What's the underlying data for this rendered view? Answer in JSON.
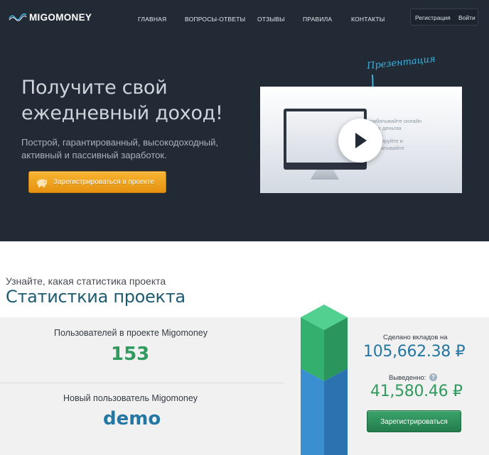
{
  "header": {
    "logo_text": "MIGOMONEY",
    "nav": [
      {
        "label": "ГЛАВНАЯ"
      },
      {
        "label": "ВОПРОСЫ-ОТВЕТЫ"
      },
      {
        "label": "ОТЗЫВЫ"
      },
      {
        "label": "ПРАВИЛА"
      },
      {
        "label": "КОНТАКТЫ"
      }
    ],
    "register_label": "Регистрация",
    "login_label": "Войти"
  },
  "hero": {
    "title": "Получите свой ежедневный доход!",
    "subtitle": "Построй, гарантированный, высокодоходный, активный и пассивный заработок.",
    "cta_label": "Зарегистрироваться в проекте",
    "presentation_label": "Презентация",
    "video_text_line1": "Зарабатывайте онлайн",
    "video_text_line2": "своих деньгах",
    "video_text_line3": "Инвестируйте и",
    "video_text_line4": "зарабатывайте"
  },
  "stats": {
    "kicker": "Узнайте, какая статистика проекта",
    "title": "Статисткиа проекта",
    "users_label": "Пользователей в проекте Migomoney",
    "users_value": "153",
    "new_user_label": "Новый пользователь Migomoney",
    "new_user_value": "demo",
    "deposits_label": "Сделано вкладов на",
    "deposits_value": "105,662.38 ₽",
    "withdrawn_label": "Выведенно:",
    "withdrawn_value": "41,580.46 ₽",
    "help_icon": "?",
    "register_label": "Зарегистрироваться"
  },
  "colors": {
    "header_bg": "#222a35",
    "accent_orange": "#f0a21f",
    "accent_green": "#2f9b5e",
    "accent_blue": "#2577a3",
    "presentation_blue": "#3fb2dc"
  }
}
